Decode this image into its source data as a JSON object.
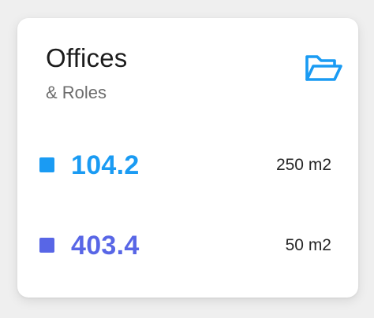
{
  "card": {
    "title": "Offices",
    "subtitle": "& Roles",
    "icon": "folder-open-icon",
    "accent_color": "#1a9bf3"
  },
  "rows": [
    {
      "value": "104.2",
      "area": "250 m2",
      "color": "#1a9bf3"
    },
    {
      "value": "403.4",
      "area": "50 m2",
      "color": "#5866e6"
    }
  ]
}
